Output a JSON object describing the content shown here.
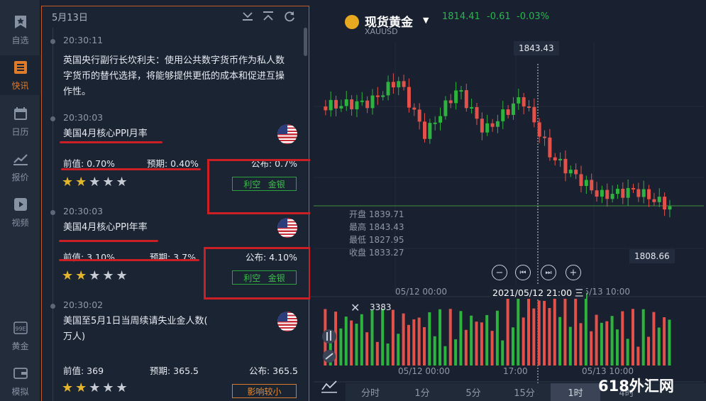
{
  "nav": [
    {
      "label": "自选",
      "icon": "star-icon"
    },
    {
      "label": "快讯",
      "icon": "news-icon"
    },
    {
      "label": "日历",
      "icon": "calendar-icon"
    },
    {
      "label": "报价",
      "icon": "quote-chart-icon"
    },
    {
      "label": "视频",
      "icon": "video-icon"
    },
    {
      "label": "黄金",
      "icon": "gold-icon"
    },
    {
      "label": "模拟",
      "icon": "wallet-icon"
    }
  ],
  "news": {
    "date": "5月13日",
    "items": [
      {
        "time": "20:30:11",
        "text": [
          "英国央行副行长坎利夫：使用公共数字货币作为私人数",
          "字货币的替代选择，将能够提供更低的成本和促进互操",
          "作性。"
        ]
      },
      {
        "time": "20:30:03",
        "title": "美国4月核心PPI月率",
        "prev": "前值: 0.70%",
        "forecast": "预期: 0.40%",
        "actual": "公布: 0.7%",
        "tag1": "利空",
        "tag2": "金银"
      },
      {
        "time": "20:30:03",
        "title": "美国4月核心PPI年率",
        "prev": "前值: 3.10%",
        "forecast": "预期: 3.7%",
        "actual": "公布: 4.10%",
        "tag1": "利空",
        "tag2": "金银"
      },
      {
        "time": "20:30:02",
        "title": "美国至5月1日当周续请失业金人数(",
        "title2": "万人)",
        "prev": "前值: 369",
        "forecast": "预期: 365.5",
        "actual": "公布: 365.5",
        "tag": "影响较小"
      }
    ]
  },
  "chart": {
    "symbol_name": "现货黄金",
    "symbol_code": "XAUUSD",
    "last": "1814.41",
    "change": "-0.61",
    "change_pct": "-0.03%",
    "high_label": "1843.43",
    "low_label": "1808.66",
    "ohlc": [
      {
        "label": "开盘",
        "value": "1839.71"
      },
      {
        "label": "最高",
        "value": "1843.43"
      },
      {
        "label": "最低",
        "value": "1827.95"
      },
      {
        "label": "收盘",
        "value": "1833.27"
      }
    ],
    "x_labels_main": [
      "05/12 00:00",
      "05/13 10:00"
    ],
    "crosshair_label": "2021/05/12 21:00 三",
    "volume": "3383",
    "x_labels_vol": [
      "05/12 00:00",
      "17:00",
      "05/13 10:00"
    ],
    "timeframes": [
      "分时",
      "1分",
      "5分",
      "15分",
      "1时",
      "4时"
    ],
    "selected_tf": "1时",
    "up_color": "#2eb33e",
    "down_color": "#e2524a"
  },
  "watermark": "618外汇网"
}
